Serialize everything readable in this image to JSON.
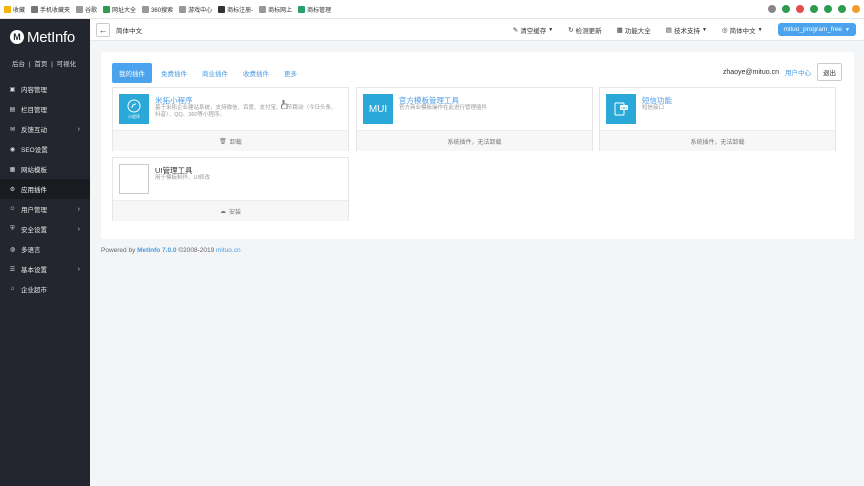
{
  "bookmarks": [
    {
      "label": "收藏",
      "icon": "star-icon",
      "color": "#f4b400"
    },
    {
      "label": "手机收藏夹",
      "icon": "phone-icon",
      "color": "#777777"
    },
    {
      "label": "谷歌",
      "icon": "page-icon",
      "color": "#999999"
    },
    {
      "label": "网址大全",
      "icon": "grid-icon",
      "color": "#2e9c4f"
    },
    {
      "label": "360搜索",
      "icon": "page-icon",
      "color": "#999999"
    },
    {
      "label": "游戏中心",
      "icon": "page-icon",
      "color": "#999999"
    },
    {
      "label": "商标注册-",
      "icon": "link-icon",
      "color": "#333333"
    },
    {
      "label": "商标网上",
      "icon": "page-icon",
      "color": "#999999"
    },
    {
      "label": "商标管理",
      "icon": "shield-icon",
      "color": "#28a06a"
    }
  ],
  "extensions": [
    "#888888",
    "#2e9c4f",
    "#e24b4b",
    "#2e9c4f",
    "#2e9c4f",
    "#2e9c4f",
    "#f29a2e"
  ],
  "sidebar": {
    "logo_text": "MetInfo",
    "quicklinks": [
      "后台",
      "首页",
      "可视化"
    ],
    "items": [
      {
        "label": "内容管理",
        "icon": "content-icon",
        "has_sub": false
      },
      {
        "label": "栏目管理",
        "icon": "column-icon",
        "has_sub": false
      },
      {
        "label": "反馈互动",
        "icon": "feedback-icon",
        "has_sub": true
      },
      {
        "label": "SEO设置",
        "icon": "seo-icon",
        "has_sub": false
      },
      {
        "label": "网站模板",
        "icon": "template-icon",
        "has_sub": false
      },
      {
        "label": "应用插件",
        "icon": "plugin-icon",
        "has_sub": false,
        "active": true
      },
      {
        "label": "用户管理",
        "icon": "user-icon",
        "has_sub": true
      },
      {
        "label": "安全设置",
        "icon": "security-icon",
        "has_sub": true
      },
      {
        "label": "多语言",
        "icon": "language-icon",
        "has_sub": false
      },
      {
        "label": "基本设置",
        "icon": "settings-icon",
        "has_sub": true
      },
      {
        "label": "企业超市",
        "icon": "store-icon",
        "has_sub": false
      }
    ]
  },
  "topbar": {
    "breadcrumb": "简体中文",
    "clear_cache": "清空缓存",
    "check_update": "检测更新",
    "features": "功能大全",
    "tech_support": "技术支持",
    "language": "简体中文",
    "user": "mituo_program_free"
  },
  "tabs": [
    "我的插件",
    "免费插件",
    "商业插件",
    "收费插件",
    "更多"
  ],
  "account": {
    "email": "zhaoye@mituo.cn",
    "center": "用户中心",
    "logout": "退出"
  },
  "cards": [
    {
      "title": "米拓小程序",
      "desc": "基于米拓企业建站系统，支持微信、百度、支付宝、字节跳动（今日头条、抖音）、QQ、360等小程序。",
      "footer": "卸载",
      "icon_label": "小程序",
      "icon_bg": "#2aa9d8",
      "footer_icon": "trash-icon"
    },
    {
      "title": "官方模板管理工具",
      "desc": "官方商业模板操作在此进行管理插件",
      "footer": "系统插件，无法卸载",
      "icon_label": "MUI",
      "icon_bg": "#2aa9d8",
      "footer_icon": ""
    },
    {
      "title": "短信功能",
      "desc": "短信接口",
      "footer": "系统插件，无法卸载",
      "icon_label": "SMS",
      "icon_bg": "#2aa9d8",
      "footer_icon": ""
    },
    {
      "title": "UI管理工具",
      "desc": "用于模板制作、UI修改",
      "footer": "安装",
      "icon_label": "",
      "icon_bg": "#ffffff",
      "footer_icon": "cloud-download-icon"
    }
  ],
  "footer": {
    "prefix": "Powered by",
    "product": "MetInfo 7.0.0",
    "copyright": "©2008-2019",
    "site": "mituo.cn"
  }
}
